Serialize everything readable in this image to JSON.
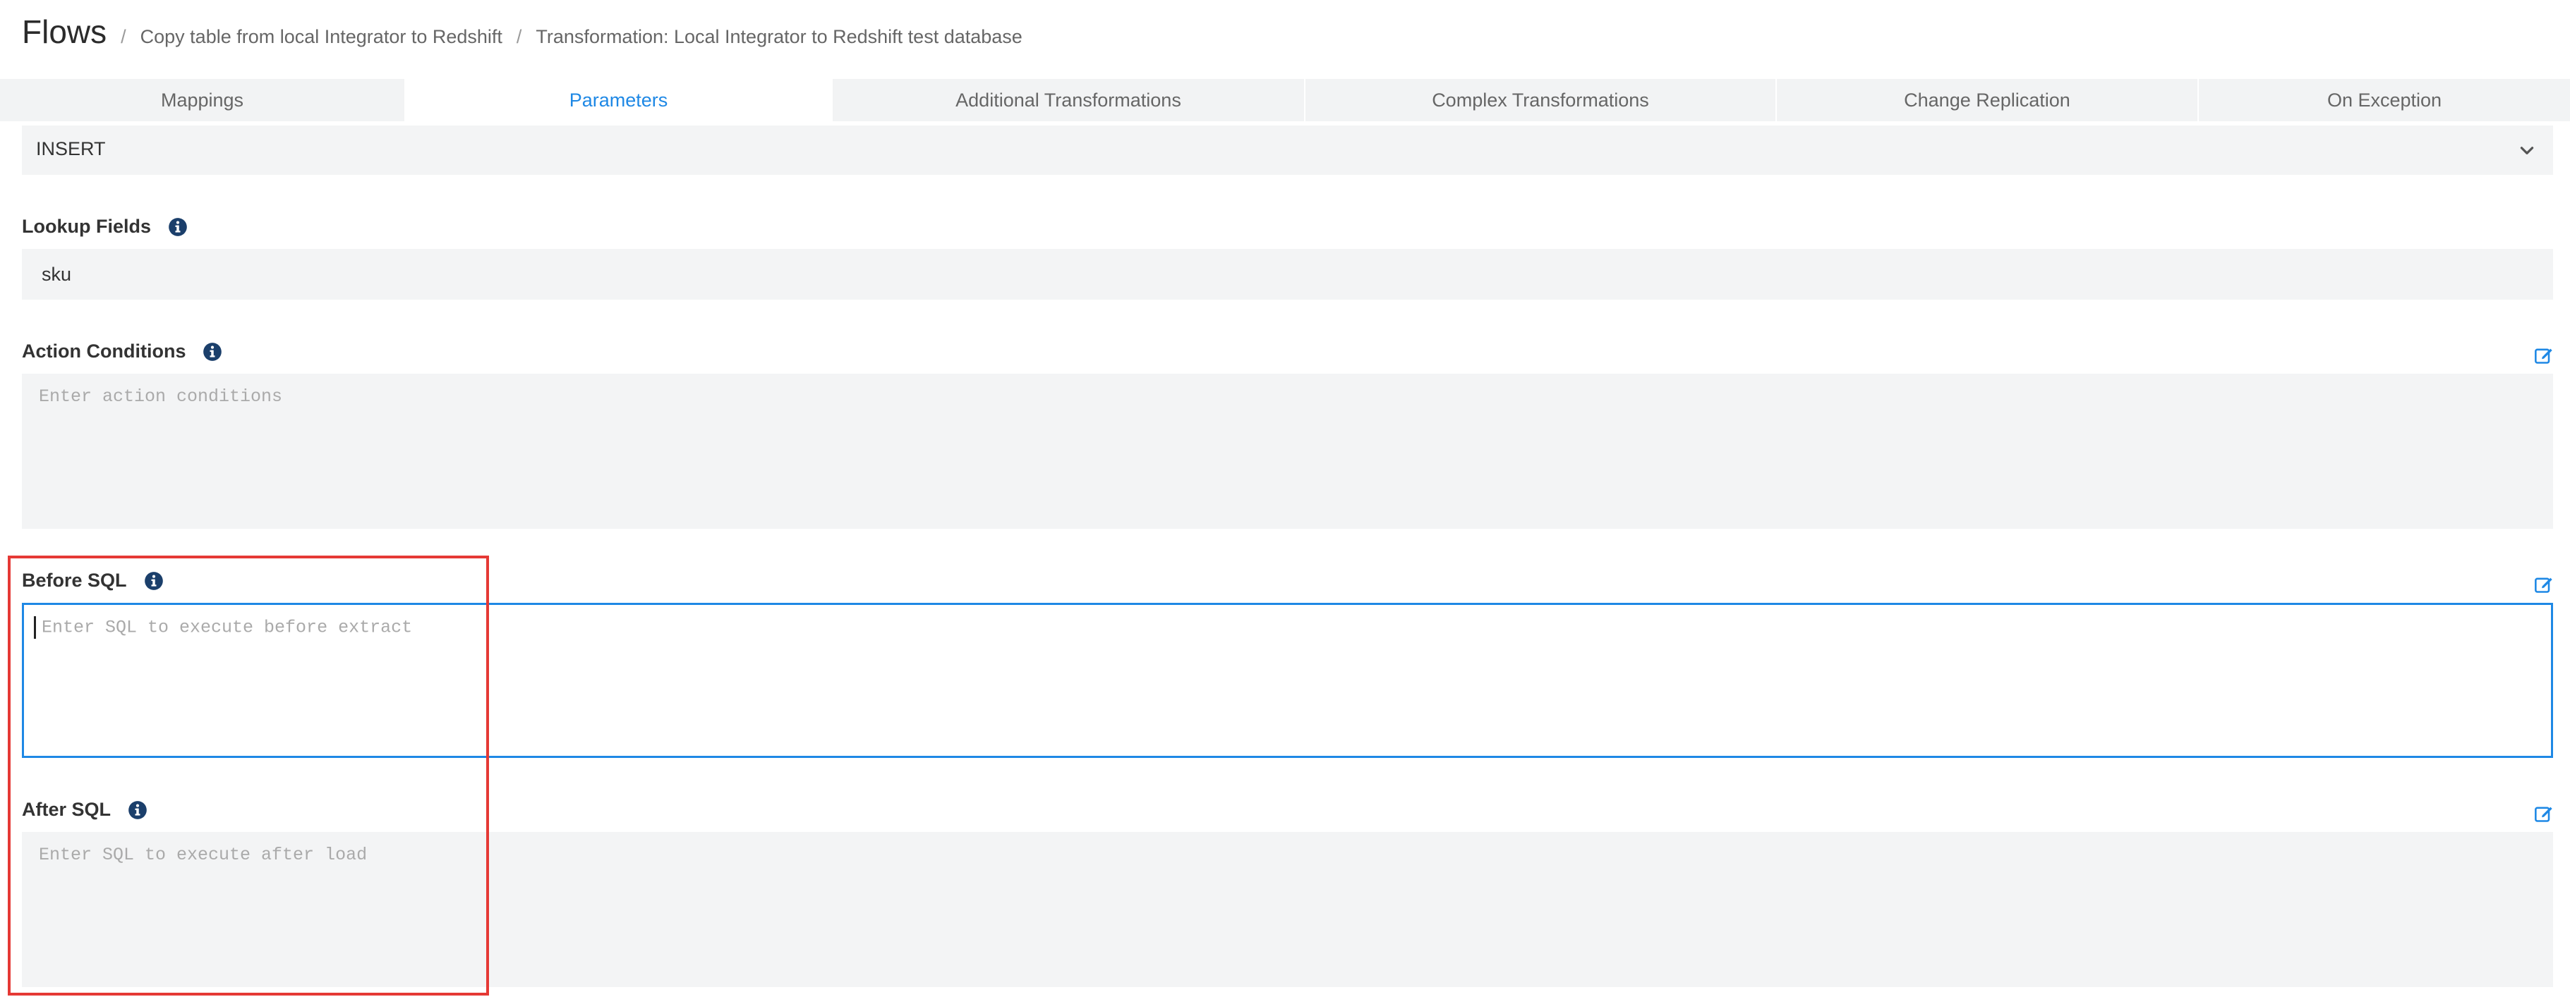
{
  "header": {
    "title": "Flows",
    "separator": "/",
    "breadcrumbs": [
      "Copy table from local Integrator to Redshift",
      "Transformation: Local Integrator to Redshift test database"
    ]
  },
  "tabs": [
    {
      "label": "Mappings"
    },
    {
      "label": "Parameters",
      "active": true
    },
    {
      "label": "Additional Transformations"
    },
    {
      "label": "Complex Transformations"
    },
    {
      "label": "Change Replication"
    },
    {
      "label": "On Exception"
    }
  ],
  "action_select": {
    "value": "INSERT"
  },
  "lookup_fields": {
    "label": "Lookup Fields",
    "value": "sku"
  },
  "action_conditions": {
    "label": "Action Conditions",
    "placeholder": "Enter action conditions"
  },
  "before_sql": {
    "label": "Before SQL",
    "placeholder": "Enter SQL to execute before extract"
  },
  "after_sql": {
    "label": "After SQL",
    "placeholder": "Enter SQL to execute after load"
  },
  "colors": {
    "accent": "#1e88e5",
    "info_icon": "#1b3f6b",
    "highlight": "#e53935",
    "field_bg": "#f3f4f5"
  },
  "icons": [
    "info-icon",
    "edit-icon",
    "chevron-down-icon"
  ]
}
